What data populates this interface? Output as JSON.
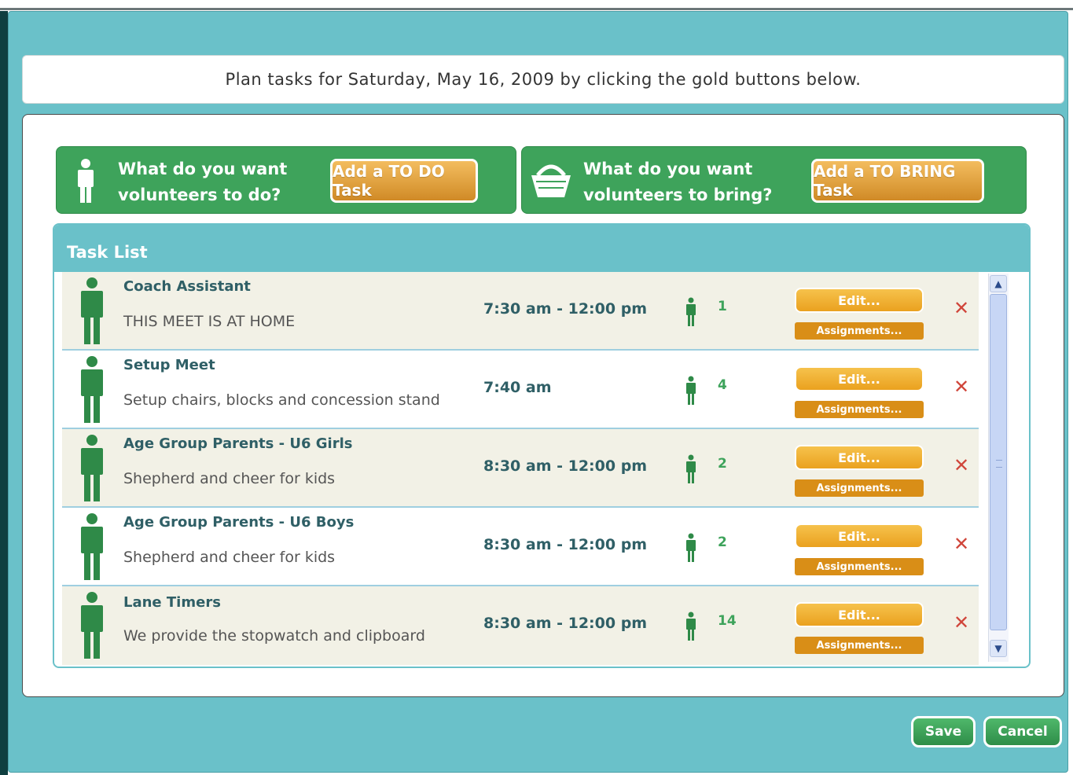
{
  "banner": {
    "text": "Plan tasks for Saturday, May 16, 2009 by clicking the gold buttons below."
  },
  "todo": {
    "question_line1": "What do you want",
    "question_line2": "volunteers to do?",
    "button": "Add a TO DO Task"
  },
  "bring": {
    "question_line1": "What do you want",
    "question_line2": "volunteers to bring?",
    "button": "Add a TO BRING Task"
  },
  "task_list": {
    "title": "Task List",
    "rows": [
      {
        "title": "Coach Assistant",
        "description": "THIS MEET IS AT HOME",
        "time": "7:30 am - 12:00 pm",
        "count": "1",
        "edit": "Edit...",
        "assignments": "Assignments..."
      },
      {
        "title": "Setup Meet",
        "description": "Setup chairs, blocks and concession stand",
        "time": "7:40 am",
        "count": "4",
        "edit": "Edit...",
        "assignments": "Assignments..."
      },
      {
        "title": "Age Group Parents - U6 Girls",
        "description": "Shepherd and cheer for kids",
        "time": "8:30 am - 12:00 pm",
        "count": "2",
        "edit": "Edit...",
        "assignments": "Assignments..."
      },
      {
        "title": "Age Group Parents - U6 Boys",
        "description": "Shepherd and cheer for kids",
        "time": "8:30 am - 12:00 pm",
        "count": "2",
        "edit": "Edit...",
        "assignments": "Assignments..."
      },
      {
        "title": "Lane Timers",
        "description": "We provide the stopwatch and clipboard",
        "time": "8:30 am - 12:00 pm",
        "count": "14",
        "edit": "Edit...",
        "assignments": "Assignments..."
      }
    ],
    "delete_glyph": "✕"
  },
  "footer": {
    "save": "Save",
    "cancel": "Cancel"
  },
  "colors": {
    "teal": "#6ac1c9",
    "green": "#3ea35b",
    "gold": "#eaa11f",
    "delete": "#d0453a"
  }
}
